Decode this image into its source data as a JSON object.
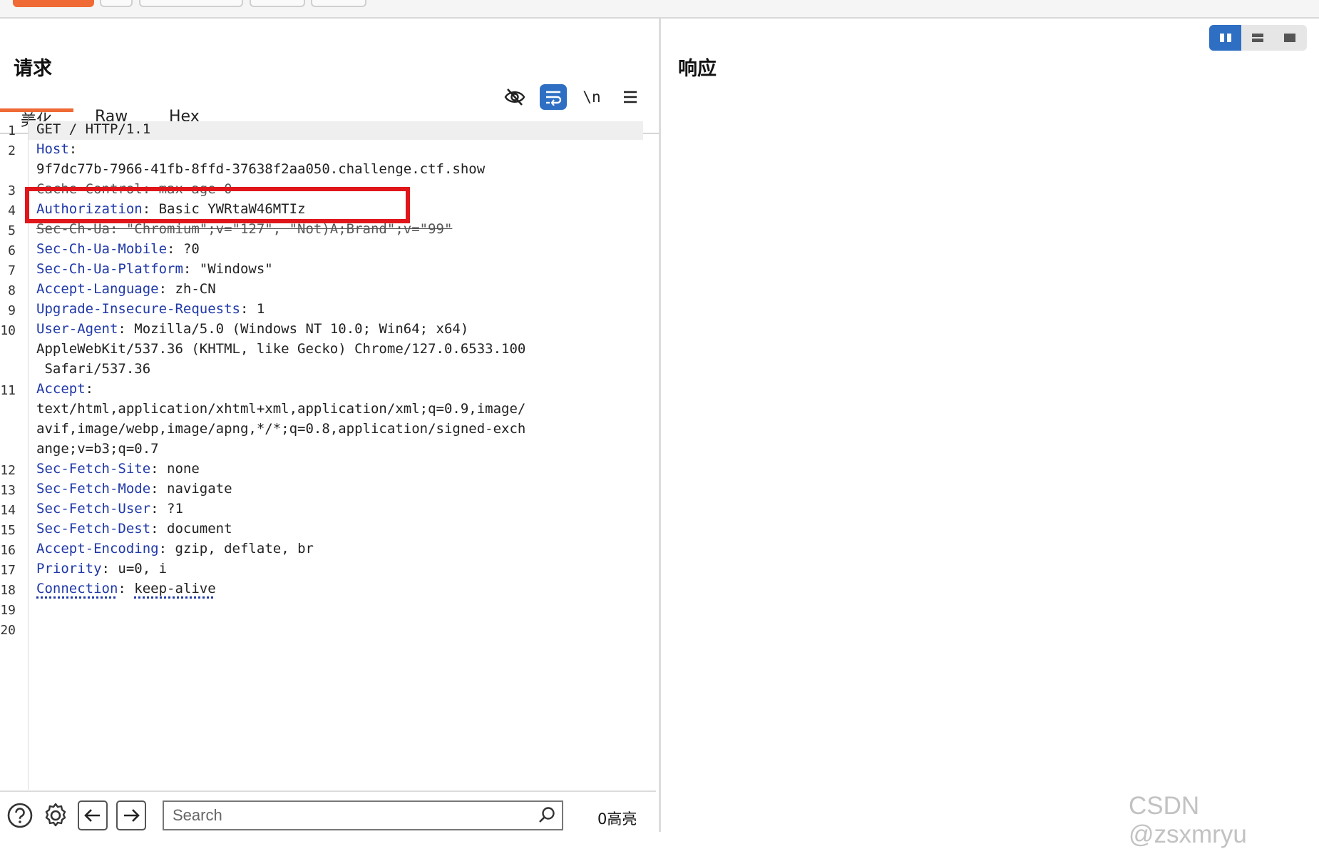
{
  "request": {
    "title": "请求",
    "tabs": [
      {
        "label": "美化",
        "active": true
      },
      {
        "label": "Raw",
        "active": false
      },
      {
        "label": "Hex",
        "active": false
      }
    ],
    "toolbar": {
      "hide_icon": "eye-slash-icon",
      "wrap_icon": "word-wrap-icon",
      "newline_label": "\\n",
      "menu_icon": "hamburger-icon"
    },
    "lines": [
      {
        "n": "1",
        "text": "GET / HTTP/1.1"
      },
      {
        "n": "2",
        "key": "Host",
        "sep": ":",
        "val": ""
      },
      {
        "n": "",
        "text": "9f7dc77b-7966-41fb-8ffd-37638f2aa050.challenge.ctf.show"
      },
      {
        "n": "3",
        "text": "Cache-Control: max-age=0"
      },
      {
        "n": "4",
        "key": "Authorization",
        "sep": ": ",
        "val": "Basic YWRtaW46MTIz"
      },
      {
        "n": "5",
        "text": "Sec-Ch-Ua: \"Chromium\";v=\"127\", \"Not)A;Brand\";v=\"99\""
      },
      {
        "n": "6",
        "key": "Sec-Ch-Ua-Mobile",
        "sep": ": ",
        "val": "?0"
      },
      {
        "n": "7",
        "key": "Sec-Ch-Ua-Platform",
        "sep": ": ",
        "val": "\"Windows\""
      },
      {
        "n": "8",
        "key": "Accept-Language",
        "sep": ": ",
        "val": "zh-CN"
      },
      {
        "n": "9",
        "key": "Upgrade-Insecure-Requests",
        "sep": ": ",
        "val": "1"
      },
      {
        "n": "10",
        "key": "User-Agent",
        "sep": ": ",
        "val": "Mozilla/5.0 (Windows NT 10.0; Win64; x64)"
      },
      {
        "n": "",
        "text": "AppleWebKit/537.36 (KHTML, like Gecko) Chrome/127.0.6533.100"
      },
      {
        "n": "",
        "text": " Safari/537.36"
      },
      {
        "n": "11",
        "key": "Accept",
        "sep": ":",
        "val": ""
      },
      {
        "n": "",
        "text": "text/html,application/xhtml+xml,application/xml;q=0.9,image/"
      },
      {
        "n": "",
        "text": "avif,image/webp,image/apng,*/*;q=0.8,application/signed-exch"
      },
      {
        "n": "",
        "text": "ange;v=b3;q=0.7"
      },
      {
        "n": "12",
        "key": "Sec-Fetch-Site",
        "sep": ": ",
        "val": "none"
      },
      {
        "n": "13",
        "key": "Sec-Fetch-Mode",
        "sep": ": ",
        "val": "navigate"
      },
      {
        "n": "14",
        "key": "Sec-Fetch-User",
        "sep": ": ",
        "val": "?1"
      },
      {
        "n": "15",
        "key": "Sec-Fetch-Dest",
        "sep": ": ",
        "val": "document"
      },
      {
        "n": "16",
        "key": "Accept-Encoding",
        "sep": ": ",
        "val": "gzip, deflate, br"
      },
      {
        "n": "17",
        "key": "Priority",
        "sep": ": ",
        "val": "u=0, i"
      },
      {
        "n": "18",
        "key": "Connection",
        "sep": ": ",
        "val": "keep-alive"
      },
      {
        "n": "19",
        "text": ""
      },
      {
        "n": "20",
        "text": ""
      }
    ],
    "bottom": {
      "search_placeholder": "Search",
      "highlights": "0高亮"
    }
  },
  "response": {
    "title": "响应"
  },
  "watermark": "CSDN @zsxmryu",
  "colors": {
    "accent": "#ef6a35",
    "primary": "#2e6fc3",
    "header_key": "#1f38a8",
    "highlight_box": "#e0161b"
  }
}
